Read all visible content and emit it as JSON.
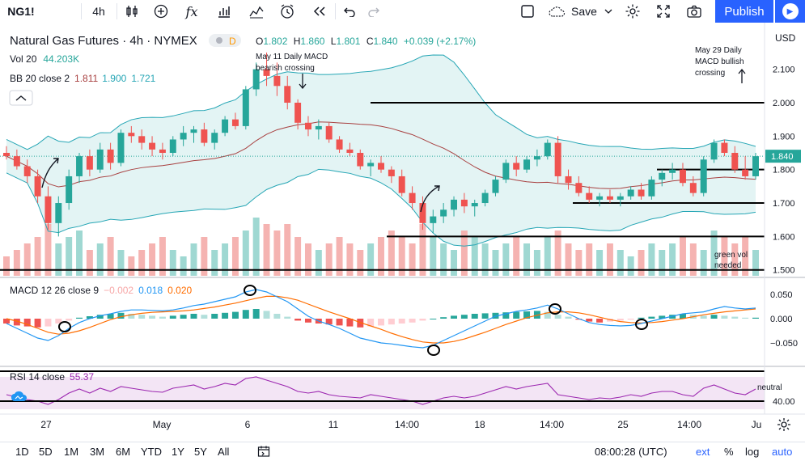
{
  "toolbar": {
    "symbol": "NG1!",
    "interval": "4h",
    "save": "Save",
    "publish": "Publish"
  },
  "legend": {
    "title": "Natural Gas Futures · 4h · NYMEX",
    "badge": "D",
    "o_label": "O",
    "o": "1.802",
    "h_label": "H",
    "h": "1.860",
    "l_label": "L",
    "l": "1.801",
    "c_label": "C",
    "c": "1.840",
    "change": "+0.039 (+2.17%)",
    "vol_label": "Vol 20",
    "vol": "44.203K",
    "bb_label": "BB 20 close 2",
    "bb1": "1.811",
    "bb2": "1.900",
    "bb3": "1.721",
    "macd_label": "MACD 12 26 close 9",
    "macd1": "−0.002",
    "macd2": "0.018",
    "macd3": "0.020",
    "rsi_label": "RSI 14 close",
    "rsi": "55.37"
  },
  "annotations": {
    "may11_line1": "May 11 Daily MACD",
    "may11_line2": "bearish crossing",
    "may29_line1": "May 29 Daily",
    "may29_line2": "MACD bullish",
    "may29_line3": "crossing",
    "greenvol1": "green vol",
    "greenvol2": "needed",
    "neutral": "neutral"
  },
  "axis": {
    "currency": "USD",
    "price_ticks": [
      "2.100",
      "2.000",
      "1.900",
      "1.800",
      "1.700",
      "1.600",
      "1.500"
    ],
    "current_price": "1.840",
    "macd_ticks": [
      "0.050",
      "0.000",
      "−0.050"
    ],
    "rsi_tick": "40.00",
    "time_ticks": [
      "27",
      "May",
      "6",
      "11",
      "14:00",
      "18",
      "14:00",
      "25",
      "14:00",
      "Ju"
    ]
  },
  "bottombar": {
    "ranges": [
      "1D",
      "5D",
      "1M",
      "3M",
      "6M",
      "YTD",
      "1Y",
      "5Y",
      "All"
    ],
    "time": "08:00:28 (UTC)",
    "ext": "ext",
    "pct": "%",
    "log": "log",
    "auto": "auto"
  },
  "colors": {
    "up": "#26a69a",
    "down": "#ef5350",
    "bb_fill": "#e3f4f4",
    "bb_band": "#26a6b5",
    "bb_basis": "#a84040",
    "macd_line": "#2196f3",
    "signal_line": "#ff6d00",
    "rsi_line": "#9c27b0",
    "rsi_fill": "#f3e5f5"
  },
  "chart_data": {
    "type": "candlestick",
    "price_range": [
      1.5,
      2.2
    ],
    "horizontal_levels": [
      2.0,
      1.8,
      1.7,
      1.6
    ],
    "ohlc": [
      [
        1.85,
        1.87,
        1.83,
        1.84
      ],
      [
        1.84,
        1.86,
        1.8,
        1.81
      ],
      [
        1.81,
        1.83,
        1.76,
        1.78
      ],
      [
        1.78,
        1.8,
        1.7,
        1.72
      ],
      [
        1.72,
        1.75,
        1.62,
        1.64
      ],
      [
        1.64,
        1.72,
        1.6,
        1.7
      ],
      [
        1.7,
        1.8,
        1.68,
        1.78
      ],
      [
        1.78,
        1.85,
        1.76,
        1.84
      ],
      [
        1.84,
        1.86,
        1.78,
        1.8
      ],
      [
        1.8,
        1.88,
        1.79,
        1.86
      ],
      [
        1.86,
        1.88,
        1.8,
        1.82
      ],
      [
        1.82,
        1.92,
        1.81,
        1.91
      ],
      [
        1.91,
        1.93,
        1.88,
        1.9
      ],
      [
        1.9,
        1.92,
        1.86,
        1.88
      ],
      [
        1.88,
        1.9,
        1.84,
        1.86
      ],
      [
        1.86,
        1.88,
        1.83,
        1.85
      ],
      [
        1.85,
        1.9,
        1.84,
        1.89
      ],
      [
        1.89,
        1.93,
        1.87,
        1.91
      ],
      [
        1.91,
        1.93,
        1.88,
        1.92
      ],
      [
        1.92,
        1.94,
        1.87,
        1.88
      ],
      [
        1.88,
        1.92,
        1.86,
        1.91
      ],
      [
        1.91,
        1.96,
        1.9,
        1.95
      ],
      [
        1.95,
        1.97,
        1.92,
        1.93
      ],
      [
        1.93,
        2.05,
        1.92,
        2.04
      ],
      [
        2.04,
        2.12,
        2.02,
        2.1
      ],
      [
        2.1,
        2.15,
        2.05,
        2.08
      ],
      [
        2.08,
        2.12,
        2.02,
        2.05
      ],
      [
        2.05,
        2.08,
        1.98,
        2.0
      ],
      [
        2.0,
        2.01,
        1.92,
        1.94
      ],
      [
        1.94,
        1.96,
        1.9,
        1.92
      ],
      [
        1.92,
        1.95,
        1.89,
        1.93
      ],
      [
        1.93,
        1.94,
        1.88,
        1.89
      ],
      [
        1.89,
        1.9,
        1.85,
        1.86
      ],
      [
        1.86,
        1.88,
        1.84,
        1.85
      ],
      [
        1.85,
        1.86,
        1.8,
        1.81
      ],
      [
        1.81,
        1.83,
        1.78,
        1.82
      ],
      [
        1.82,
        1.84,
        1.79,
        1.8
      ],
      [
        1.8,
        1.81,
        1.76,
        1.78
      ],
      [
        1.78,
        1.8,
        1.72,
        1.73
      ],
      [
        1.73,
        1.75,
        1.68,
        1.7
      ],
      [
        1.7,
        1.72,
        1.62,
        1.64
      ],
      [
        1.64,
        1.68,
        1.61,
        1.66
      ],
      [
        1.66,
        1.7,
        1.64,
        1.68
      ],
      [
        1.68,
        1.72,
        1.66,
        1.71
      ],
      [
        1.71,
        1.73,
        1.67,
        1.69
      ],
      [
        1.69,
        1.71,
        1.66,
        1.7
      ],
      [
        1.7,
        1.74,
        1.69,
        1.73
      ],
      [
        1.73,
        1.78,
        1.72,
        1.77
      ],
      [
        1.77,
        1.83,
        1.76,
        1.82
      ],
      [
        1.82,
        1.84,
        1.78,
        1.8
      ],
      [
        1.8,
        1.84,
        1.79,
        1.83
      ],
      [
        1.83,
        1.86,
        1.81,
        1.84
      ],
      [
        1.84,
        1.89,
        1.83,
        1.88
      ],
      [
        1.88,
        1.9,
        1.76,
        1.78
      ],
      [
        1.78,
        1.8,
        1.74,
        1.76
      ],
      [
        1.76,
        1.78,
        1.72,
        1.73
      ],
      [
        1.73,
        1.75,
        1.7,
        1.71
      ],
      [
        1.71,
        1.73,
        1.69,
        1.72
      ],
      [
        1.72,
        1.74,
        1.7,
        1.71
      ],
      [
        1.71,
        1.73,
        1.69,
        1.72
      ],
      [
        1.72,
        1.75,
        1.71,
        1.74
      ],
      [
        1.74,
        1.76,
        1.71,
        1.72
      ],
      [
        1.72,
        1.78,
        1.71,
        1.77
      ],
      [
        1.77,
        1.8,
        1.75,
        1.79
      ],
      [
        1.79,
        1.82,
        1.77,
        1.8
      ],
      [
        1.8,
        1.82,
        1.75,
        1.76
      ],
      [
        1.76,
        1.78,
        1.72,
        1.73
      ],
      [
        1.73,
        1.84,
        1.72,
        1.83
      ],
      [
        1.83,
        1.89,
        1.82,
        1.88
      ],
      [
        1.88,
        1.89,
        1.84,
        1.85
      ],
      [
        1.85,
        1.87,
        1.79,
        1.8
      ],
      [
        1.8,
        1.84,
        1.77,
        1.78
      ],
      [
        1.78,
        1.85,
        1.77,
        1.84
      ]
    ],
    "volume": [
      3,
      4,
      5,
      6,
      8,
      5,
      6,
      7,
      4,
      5,
      6,
      4,
      3,
      4,
      5,
      6,
      4,
      3,
      5,
      6,
      4,
      5,
      6,
      7,
      9,
      8,
      7,
      8,
      6,
      5,
      4,
      5,
      6,
      5,
      4,
      5,
      6,
      7,
      6,
      5,
      8,
      6,
      5,
      4,
      7,
      6,
      5,
      4,
      5,
      6,
      5,
      4,
      6,
      7,
      5,
      4,
      5,
      4,
      5,
      4,
      3,
      4,
      5,
      4,
      5,
      6,
      5,
      4,
      7,
      6,
      5,
      6,
      4
    ],
    "macd_hist": [
      -0.01,
      -0.014,
      -0.016,
      -0.018,
      -0.016,
      -0.01,
      -0.004,
      0.002,
      0.005,
      0.008,
      0.01,
      0.012,
      0.01,
      0.008,
      0.006,
      0.004,
      0.006,
      0.008,
      0.01,
      0.008,
      0.01,
      0.012,
      0.014,
      0.018,
      0.02,
      0.016,
      0.01,
      0.004,
      -0.004,
      -0.008,
      -0.01,
      -0.012,
      -0.014,
      -0.016,
      -0.018,
      -0.016,
      -0.014,
      -0.012,
      -0.01,
      -0.008,
      -0.004,
      0.0,
      0.003,
      0.006,
      0.008,
      0.01,
      0.011,
      0.012,
      0.013,
      0.014,
      0.015,
      0.016,
      0.014,
      0.008,
      0.004,
      -0.002,
      -0.006,
      -0.008,
      -0.006,
      -0.004,
      -0.002,
      0.002,
      0.004,
      0.006,
      0.008,
      0.01,
      0.008,
      0.006,
      0.008,
      0.006,
      0.004,
      0.002,
      0.002
    ],
    "macd_line": [
      -0.01,
      -0.02,
      -0.03,
      -0.04,
      -0.045,
      -0.035,
      -0.02,
      -0.008,
      0.0,
      0.006,
      0.01,
      0.015,
      0.018,
      0.018,
      0.017,
      0.016,
      0.018,
      0.022,
      0.027,
      0.03,
      0.035,
      0.04,
      0.045,
      0.055,
      0.06,
      0.055,
      0.045,
      0.035,
      0.02,
      0.005,
      -0.005,
      -0.012,
      -0.02,
      -0.03,
      -0.04,
      -0.045,
      -0.05,
      -0.052,
      -0.055,
      -0.058,
      -0.06,
      -0.055,
      -0.045,
      -0.035,
      -0.025,
      -0.015,
      -0.005,
      0.005,
      0.01,
      0.015,
      0.018,
      0.022,
      0.028,
      0.02,
      0.01,
      0.0,
      -0.008,
      -0.012,
      -0.014,
      -0.015,
      -0.014,
      -0.01,
      -0.005,
      0.0,
      0.005,
      0.01,
      0.012,
      0.014,
      0.02,
      0.025,
      0.022,
      0.02,
      0.022
    ],
    "signal_line": [
      0.0,
      -0.005,
      -0.012,
      -0.02,
      -0.028,
      -0.032,
      -0.03,
      -0.025,
      -0.018,
      -0.01,
      -0.002,
      0.004,
      0.008,
      0.011,
      0.013,
      0.014,
      0.015,
      0.016,
      0.018,
      0.021,
      0.024,
      0.028,
      0.032,
      0.037,
      0.042,
      0.046,
      0.046,
      0.043,
      0.038,
      0.03,
      0.022,
      0.014,
      0.007,
      0.0,
      -0.008,
      -0.015,
      -0.022,
      -0.03,
      -0.037,
      -0.043,
      -0.048,
      -0.05,
      -0.05,
      -0.047,
      -0.042,
      -0.035,
      -0.028,
      -0.02,
      -0.012,
      -0.005,
      0.002,
      0.007,
      0.012,
      0.014,
      0.014,
      0.012,
      0.008,
      0.003,
      -0.002,
      -0.006,
      -0.008,
      -0.009,
      -0.008,
      -0.006,
      -0.003,
      0.0,
      0.004,
      0.008,
      0.011,
      0.014,
      0.016,
      0.018,
      0.02
    ],
    "rsi": [
      48,
      45,
      42,
      40,
      36,
      42,
      50,
      55,
      50,
      56,
      52,
      58,
      56,
      54,
      52,
      51,
      56,
      58,
      60,
      55,
      58,
      62,
      60,
      68,
      70,
      66,
      62,
      58,
      52,
      50,
      52,
      48,
      46,
      45,
      44,
      48,
      46,
      44,
      42,
      40,
      36,
      40,
      44,
      46,
      44,
      46,
      50,
      54,
      58,
      55,
      58,
      60,
      62,
      48,
      46,
      44,
      42,
      44,
      43,
      45,
      48,
      46,
      50,
      52,
      52,
      48,
      46,
      56,
      60,
      55,
      50,
      48,
      55
    ]
  }
}
